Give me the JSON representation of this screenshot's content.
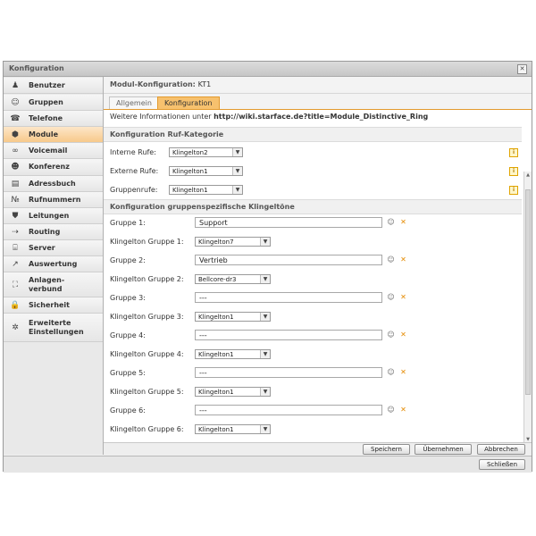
{
  "window": {
    "title": "Konfiguration",
    "close_icon": "close-icon"
  },
  "sidebar": {
    "items": [
      {
        "label": "Benutzer",
        "icon": "user-icon",
        "glyph": "♟"
      },
      {
        "label": "Gruppen",
        "icon": "group-icon",
        "glyph": "☺"
      },
      {
        "label": "Telefone",
        "icon": "phone-icon",
        "glyph": "☎"
      },
      {
        "label": "Module",
        "icon": "module-icon",
        "glyph": "⬢"
      },
      {
        "label": "Voicemail",
        "icon": "voicemail-icon",
        "glyph": "∞"
      },
      {
        "label": "Konferenz",
        "icon": "conference-icon",
        "glyph": "☻"
      },
      {
        "label": "Adressbuch",
        "icon": "addressbook-icon",
        "glyph": "▤"
      },
      {
        "label": "Rufnummern",
        "icon": "numbers-icon",
        "glyph": "№"
      },
      {
        "label": "Leitungen",
        "icon": "lines-icon",
        "glyph": "⛊"
      },
      {
        "label": "Routing",
        "icon": "routing-icon",
        "glyph": "⇢"
      },
      {
        "label": "Server",
        "icon": "server-icon",
        "glyph": "⌸"
      },
      {
        "label": "Auswertung",
        "icon": "chart-icon",
        "glyph": "↗"
      },
      {
        "label": "Anlagen-\nverbund",
        "icon": "network-icon",
        "glyph": "⛶"
      },
      {
        "label": "Sicherheit",
        "icon": "lock-icon",
        "glyph": "🔒"
      },
      {
        "label": "Erweiterte\nEinstellungen",
        "icon": "advanced-settings-icon",
        "glyph": "✲"
      }
    ],
    "active": "Module"
  },
  "main": {
    "header_label": "Modul-Konfiguration:",
    "header_value": "KT1",
    "tabs": [
      {
        "label": "Allgemein"
      },
      {
        "label": "Konfiguration"
      }
    ],
    "active_tab": "Konfiguration",
    "info_prefix": "Weitere Informationen unter ",
    "info_link": "http://wiki.starface.de?title=Module_Distinctive_Ring",
    "section1": {
      "title": "Konfiguration Ruf-Kategorie",
      "rows": [
        {
          "label": "Interne Rufe:",
          "value": "Klingelton2"
        },
        {
          "label": "Externe Rufe:",
          "value": "Klingelton1"
        },
        {
          "label": "Gruppenrufe:",
          "value": "Klingelton1"
        }
      ]
    },
    "section2": {
      "title": "Konfiguration gruppenspezifische Klingeltöne",
      "groups": [
        {
          "label": "Gruppe 1:",
          "value": "Support",
          "ring_label": "Klingelton Gruppe 1:",
          "ring": "Klingelton7"
        },
        {
          "label": "Gruppe 2:",
          "value": "Vertrieb",
          "ring_label": "Klingelton Gruppe 2:",
          "ring": "Bellcore-dr3"
        },
        {
          "label": "Gruppe 3:",
          "value": "---",
          "ring_label": "Klingelton Gruppe 3:",
          "ring": "Klingelton1"
        },
        {
          "label": "Gruppe 4:",
          "value": "---",
          "ring_label": "Klingelton Gruppe 4:",
          "ring": "Klingelton1"
        },
        {
          "label": "Gruppe 5:",
          "value": "---",
          "ring_label": "Klingelton Gruppe 5:",
          "ring": "Klingelton1"
        },
        {
          "label": "Gruppe 6:",
          "value": "---",
          "ring_label": "Klingelton Gruppe 6:",
          "ring": "Klingelton1"
        }
      ]
    },
    "buttons": {
      "save": "Speichern",
      "apply": "Übernehmen",
      "cancel": "Abbrechen"
    }
  },
  "footer": {
    "close": "Schließen"
  }
}
